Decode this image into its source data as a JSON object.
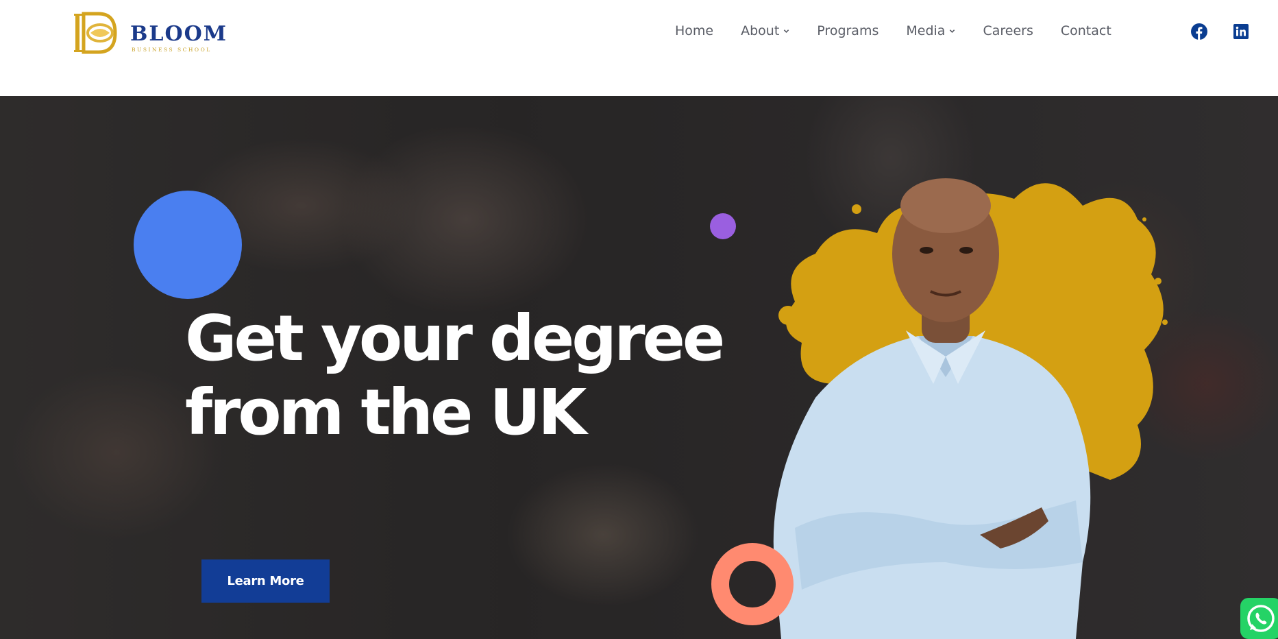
{
  "header": {
    "logo": {
      "name": "BLOOM",
      "subtitle": "BUSINESS SCHOOL",
      "icon": "bloom-logo-icon"
    },
    "nav": [
      {
        "label": "Home",
        "has_dropdown": false
      },
      {
        "label": "About",
        "has_dropdown": true
      },
      {
        "label": "Programs",
        "has_dropdown": false
      },
      {
        "label": "Media",
        "has_dropdown": true
      },
      {
        "label": "Careers",
        "has_dropdown": false
      },
      {
        "label": "Contact",
        "has_dropdown": false
      }
    ],
    "social": [
      {
        "icon": "facebook-icon",
        "color": "#0a3d91"
      },
      {
        "icon": "linkedin-icon",
        "color": "#0a3d91"
      }
    ]
  },
  "hero": {
    "headline_line1": "Get your degree",
    "headline_line2": "from the UK",
    "cta_label": "Learn More",
    "colors": {
      "cta": "#123d96",
      "blue_circle": "#4a7ff0",
      "purple_dot": "#9a5fe0",
      "ring": "#ff8a70",
      "paint_splash": "#d4a012"
    }
  },
  "floating": {
    "whatsapp_icon": "whatsapp-icon",
    "whatsapp_color": "#25d366"
  }
}
